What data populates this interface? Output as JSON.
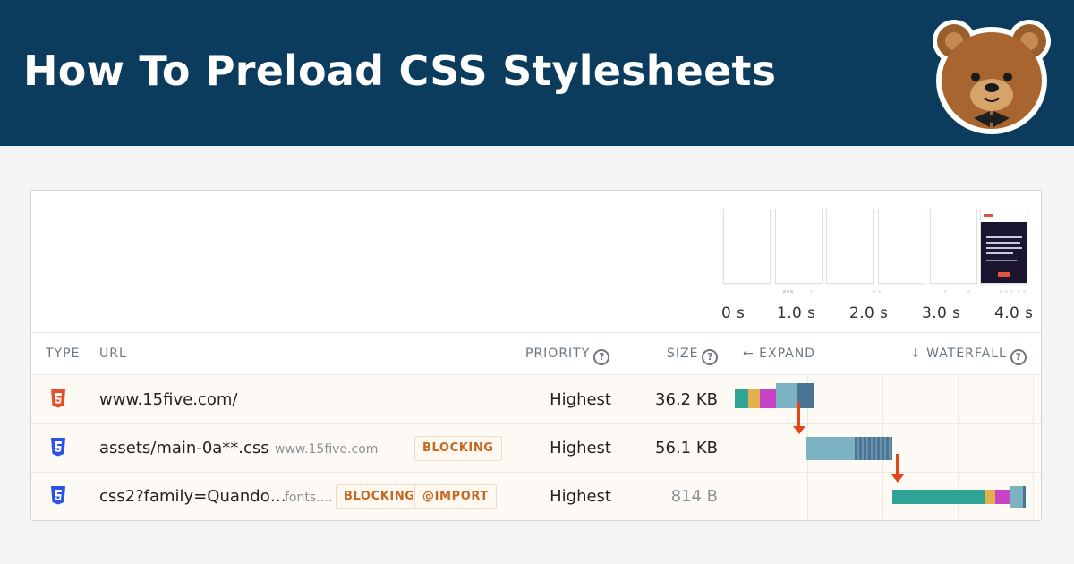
{
  "banner": {
    "title": "How To Preload CSS Stylesheets",
    "background_color": "#0c3c5d",
    "logo": "bear-mascot-icon"
  },
  "filmstrip": {
    "frames": [
      "blank",
      "blank",
      "blank",
      "blank",
      "blank",
      "page-screenshot"
    ],
    "ticks": [
      "0 s",
      "1.0 s",
      "2.0 s",
      "3.0 s",
      "4.0 s"
    ]
  },
  "table": {
    "headers": {
      "type": "TYPE",
      "url": "URL",
      "priority": "PRIORITY",
      "size": "SIZE",
      "expand": "← EXPAND",
      "waterfall": "↓ WATERFALL"
    },
    "help_glyph": "?",
    "rows": [
      {
        "type": "html5-icon",
        "url": "www.15five.com/",
        "host": "",
        "badges": [],
        "priority": "Highest",
        "size": "36.2 KB"
      },
      {
        "type": "css3-icon",
        "url": "assets/main-0a**.css",
        "host": "www.15five.com",
        "badges": [
          "BLOCKING"
        ],
        "priority": "Highest",
        "size": "56.1 KB"
      },
      {
        "type": "css3-icon",
        "url": "css2?family=Quando…",
        "host": "fonts.…",
        "badges": [
          "BLOCKING",
          "@IMPORT"
        ],
        "priority": "Highest",
        "size": "814 B"
      }
    ]
  },
  "colors": {
    "dns": "#2fa394",
    "connect": "#e0b04a",
    "ssl": "#c944c5",
    "request": "#7cb3c3",
    "download": "#4a7494",
    "dependency_arrow": "#e0461c",
    "badge_text": "#c26a23"
  }
}
